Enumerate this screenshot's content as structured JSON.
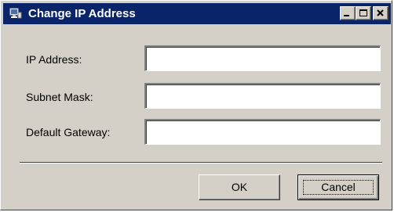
{
  "window": {
    "title": "Change IP Address",
    "icon": "network-app-icon",
    "controls": [
      "minimize-icon",
      "maximize-icon",
      "close-icon"
    ]
  },
  "fields": {
    "ip_address": {
      "label": "IP Address:",
      "value": ""
    },
    "subnet_mask": {
      "label": "Subnet Mask:",
      "value": ""
    },
    "default_gateway": {
      "label": "Default Gateway:",
      "value": ""
    }
  },
  "buttons": {
    "ok": "OK",
    "cancel": "Cancel"
  },
  "colors": {
    "titlebar": "#0a246a",
    "face": "#d4d0c8"
  }
}
